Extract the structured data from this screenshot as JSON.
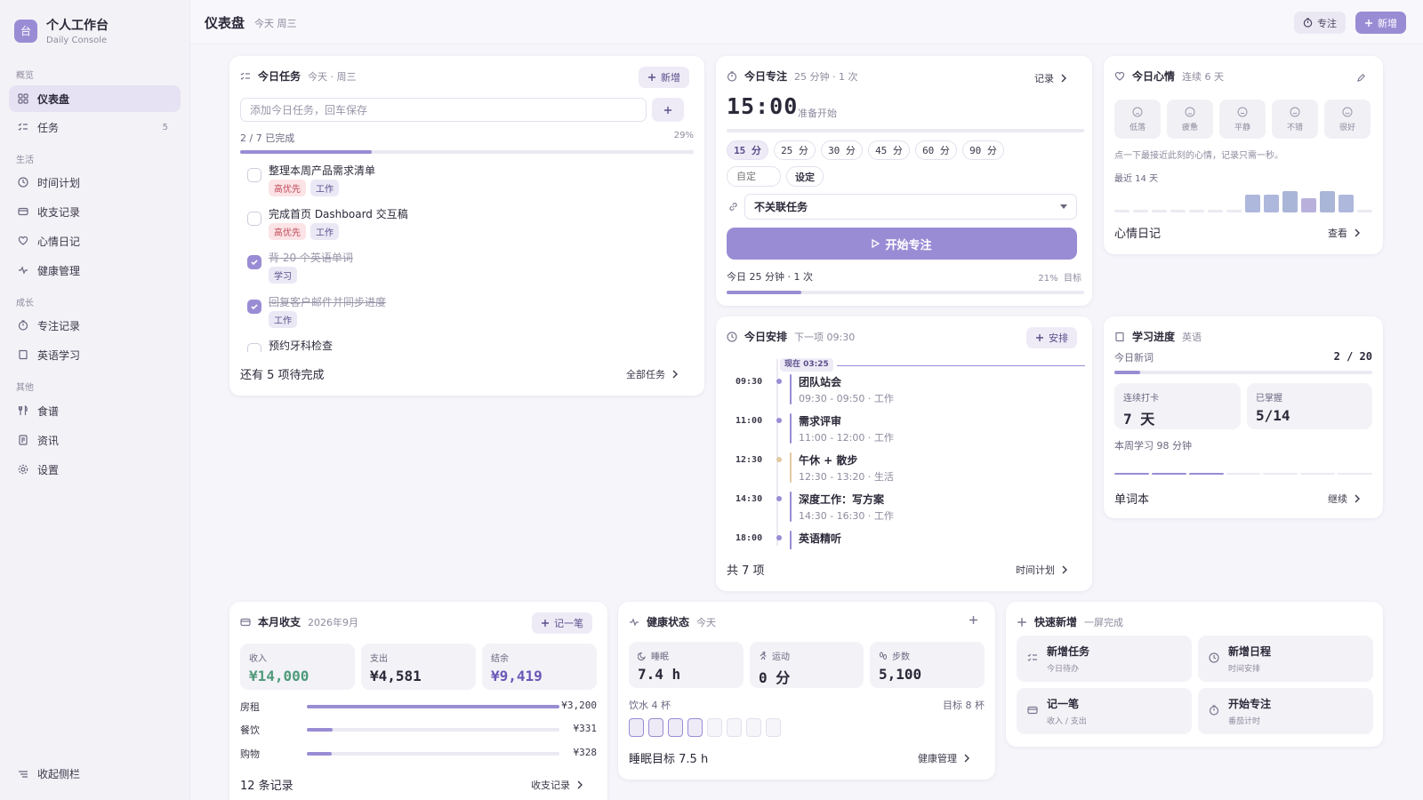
{
  "app": {
    "title": "个人工作台",
    "subtitle": "Daily Console",
    "logo_char": "台"
  },
  "sidebar": {
    "groups": [
      "概览",
      "生活",
      "成长",
      "其他"
    ],
    "items": [
      {
        "label": "仪表盘",
        "icon": "grid-icon"
      },
      {
        "label": "任务",
        "icon": "list-check-icon",
        "count": "5"
      },
      {
        "label": "时间计划",
        "icon": "clock-icon"
      },
      {
        "label": "收支记录",
        "icon": "wallet-icon"
      },
      {
        "label": "心情日记",
        "icon": "heart-icon"
      },
      {
        "label": "健康管理",
        "icon": "pulse-icon"
      },
      {
        "label": "专注记录",
        "icon": "timer-icon"
      },
      {
        "label": "英语学习",
        "icon": "book-icon"
      },
      {
        "label": "食谱",
        "icon": "utensils-icon"
      },
      {
        "label": "资讯",
        "icon": "news-icon"
      },
      {
        "label": "设置",
        "icon": "gear-icon"
      }
    ],
    "collapse_label": "收起侧栏"
  },
  "header": {
    "title": "仪表盘",
    "subtitle": "今天 周三",
    "focus_label": "专注",
    "add_label": "新增"
  },
  "tasks": {
    "title": "今日任务",
    "subtitle": "今天 · 周三",
    "add_label": "新增",
    "input_placeholder": "添加今日任务，回车保存",
    "progress_text": "2 / 7 已完成",
    "progress_percent": "29%",
    "progress_value": 0.29,
    "items": [
      {
        "name": "整理本周产品需求清单",
        "done": false,
        "tags": [
          {
            "text": "高优先",
            "kind": "hi"
          },
          {
            "text": "工作",
            "kind": "work"
          }
        ]
      },
      {
        "name": "完成首页 Dashboard 交互稿",
        "done": false,
        "tags": [
          {
            "text": "高优先",
            "kind": "hi"
          },
          {
            "text": "工作",
            "kind": "work"
          }
        ]
      },
      {
        "name": "背 20 个英语单词",
        "done": true,
        "tags": [
          {
            "text": "学习",
            "kind": "study"
          }
        ]
      },
      {
        "name": "回复客户邮件并同步进度",
        "done": true,
        "tags": [
          {
            "text": "工作",
            "kind": "work"
          }
        ]
      },
      {
        "name": "预约牙科检查",
        "done": false,
        "tags": []
      }
    ],
    "footer_text": "还有 5 项待完成",
    "footer_link": "全部任务"
  },
  "focus": {
    "title": "今日专注",
    "subtitle": "25 分钟 · 1 次",
    "record_label": "记录",
    "time": "15:00",
    "status": "准备开始",
    "durations": [
      "15 分",
      "25 分",
      "30 分",
      "45 分",
      "60 分",
      "90 分"
    ],
    "selected_duration": "15 分",
    "custom_placeholder": "自定",
    "set_label": "设定",
    "task_select": "不关联任务",
    "start_label": "开始专注",
    "summary": "今日 25 分钟 · 1 次",
    "goal_percent": "21%",
    "goal_label": "目标",
    "goal_value": 0.21
  },
  "mood": {
    "title": "今日心情",
    "subtitle": "连续 6 天",
    "options": [
      "低落",
      "疲惫",
      "平静",
      "不错",
      "很好"
    ],
    "hint": "点一下最接近此刻的心情，记录只需一秒。",
    "recent_label": "最近 14 天",
    "history": [
      0,
      0,
      0,
      0,
      0,
      0,
      0,
      3,
      3,
      4,
      2,
      4,
      3,
      0
    ],
    "footer_text": "心情日记",
    "footer_link": "查看"
  },
  "schedule": {
    "title": "今日安排",
    "subtitle": "下一项 09:30",
    "add_label": "安排",
    "now_label": "现在 03:25",
    "items": [
      {
        "time": "09:30",
        "title": "团队站会",
        "meta": "09:30 - 09:50 · 工作",
        "color": "#9a8cd4"
      },
      {
        "time": "11:00",
        "title": "需求评审",
        "meta": "11:00 - 12:00 · 工作",
        "color": "#9a8cd4"
      },
      {
        "time": "12:30",
        "title": "午休 + 散步",
        "meta": "12:30 - 13:20 · 生活",
        "color": "#e2c9a0"
      },
      {
        "time": "14:30",
        "title": "深度工作：写方案",
        "meta": "14:30 - 16:30 · 工作",
        "color": "#9a8cd4"
      },
      {
        "time": "18:00",
        "title": "英语精听",
        "meta": "",
        "color": "#9a8cd4"
      }
    ],
    "footer_text": "共 7 项",
    "footer_link": "时间计划"
  },
  "study": {
    "title": "学习进度",
    "subtitle": "英语",
    "new_words_label": "今日新词",
    "new_words_value": "2 / 20",
    "new_words_progress": 0.1,
    "streak_label": "连续打卡",
    "streak_value": "7 天",
    "mastered_label": "已掌握",
    "mastered_value": "5/14",
    "weekly": "本周学习 98 分钟",
    "week_segments": [
      1,
      1,
      1,
      0,
      0,
      0,
      0
    ],
    "footer_text": "单词本",
    "footer_link": "继续"
  },
  "finance": {
    "title": "本月收支",
    "subtitle": "2026年9月",
    "add_label": "记一笔",
    "income_label": "收入",
    "income_value": "¥14,000",
    "expense_label": "支出",
    "expense_value": "¥4,581",
    "balance_label": "结余",
    "balance_value": "¥9,419",
    "categories": [
      {
        "name": "房租",
        "value": "¥3,200",
        "ratio": 1.0
      },
      {
        "name": "餐饮",
        "value": "¥331",
        "ratio": 0.103
      },
      {
        "name": "购物",
        "value": "¥328",
        "ratio": 0.1
      }
    ],
    "footer_text": "12 条记录",
    "footer_link": "收支记录"
  },
  "health": {
    "title": "健康状态",
    "subtitle": "今天",
    "sleep_label": "睡眠",
    "sleep_value": "7.4 h",
    "exercise_label": "运动",
    "exercise_value": "0 分",
    "steps_label": "步数",
    "steps_value": "5,100",
    "water_label": "饮水 4 杯",
    "water_goal": "目标 8 杯",
    "water_cups": 4,
    "water_total": 8,
    "footer_text": "睡眠目标 7.5 h",
    "footer_link": "健康管理"
  },
  "quick": {
    "title": "快速新增",
    "subtitle": "一屏完成",
    "items": [
      {
        "title": "新增任务",
        "sub": "今日待办",
        "icon": "list-check-icon"
      },
      {
        "title": "新增日程",
        "sub": "时间安排",
        "icon": "clock-icon"
      },
      {
        "title": "记一笔",
        "sub": "收入 / 支出",
        "icon": "wallet-icon"
      },
      {
        "title": "开始专注",
        "sub": "番茄计时",
        "icon": "timer-icon"
      }
    ]
  },
  "colors": {
    "accent": "#9a8cd4",
    "income": "#4f9a7a",
    "balance": "#6a58b8",
    "danger": "#c04a5a"
  }
}
